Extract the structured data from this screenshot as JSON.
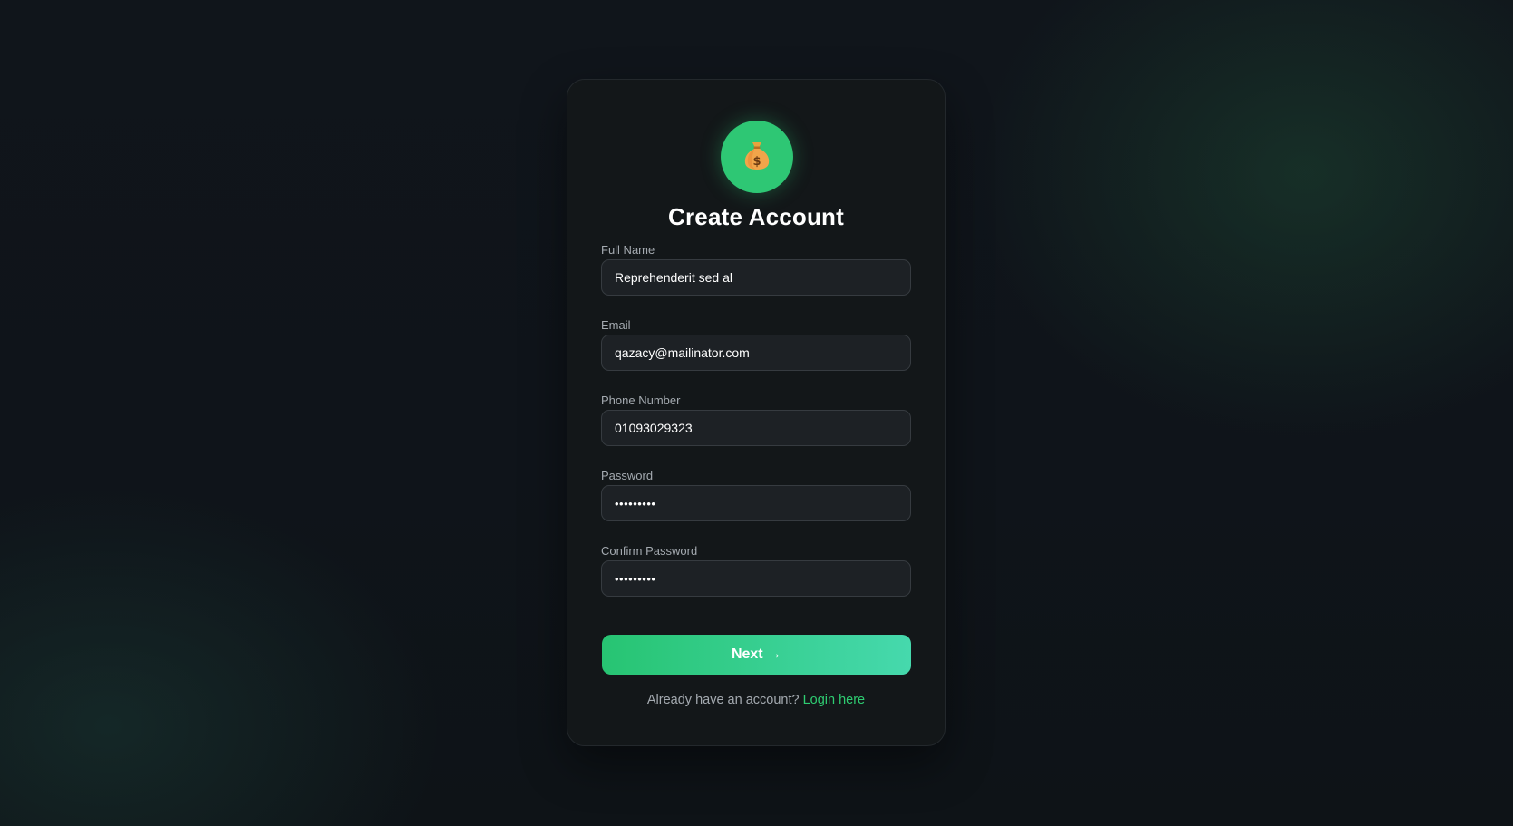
{
  "logo": {
    "icon": "money-bag-icon",
    "color": "#2ec774"
  },
  "title": "Create Account",
  "form": {
    "full_name": {
      "label": "Full Name",
      "value": "Reprehenderit sed al"
    },
    "email": {
      "label": "Email",
      "value": "qazacy@mailinator.com"
    },
    "phone": {
      "label": "Phone Number",
      "value": "01093029323"
    },
    "password": {
      "label": "Password",
      "value": "•••••••••"
    },
    "confirm_password": {
      "label": "Confirm Password",
      "value": "•••••••••"
    }
  },
  "next_button": {
    "label": "Next →"
  },
  "footer": {
    "prompt": "Already have an account?",
    "link_label": "Login here"
  },
  "colors": {
    "accent": "#2ecc71",
    "accent_end": "#46d9ad",
    "card_bg": "#131719",
    "input_bg": "#1d2125"
  }
}
